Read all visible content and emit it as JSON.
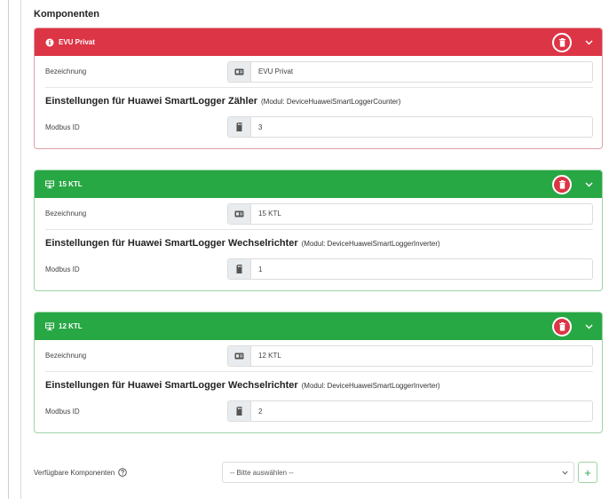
{
  "section_title": "Komponenten",
  "colors": {
    "danger": "#dc3545",
    "success": "#28a745"
  },
  "cards": [
    {
      "title": "EVU Privat",
      "header_icon": "info-circle-icon",
      "status": "danger",
      "bezeichnung_label": "Bezeichnung",
      "bezeichnung_value": "EVU Privat",
      "settings_title": "Einstellungen für Huawei SmartLogger Zähler",
      "settings_module": "(Modul: DeviceHuaweiSmartLoggerCounter)",
      "modbus_label": "Modbus ID",
      "modbus_value": "3"
    },
    {
      "title": "15 KTL",
      "header_icon": "solar-panel-icon",
      "status": "success",
      "bezeichnung_label": "Bezeichnung",
      "bezeichnung_value": "15 KTL",
      "settings_title": "Einstellungen für Huawei SmartLogger Wechselrichter",
      "settings_module": "(Modul: DeviceHuaweiSmartLoggerInverter)",
      "modbus_label": "Modbus ID",
      "modbus_value": "1"
    },
    {
      "title": "12 KTL",
      "header_icon": "solar-panel-icon",
      "status": "success",
      "bezeichnung_label": "Bezeichnung",
      "bezeichnung_value": "12 KTL",
      "settings_title": "Einstellungen für Huawei SmartLogger Wechselrichter",
      "settings_module": "(Modul: DeviceHuaweiSmartLoggerInverter)",
      "modbus_label": "Modbus ID",
      "modbus_value": "2"
    }
  ],
  "available": {
    "label": "Verfügbare Komponenten",
    "select_placeholder": "-- Bitte auswählen --",
    "add_label": "+"
  }
}
